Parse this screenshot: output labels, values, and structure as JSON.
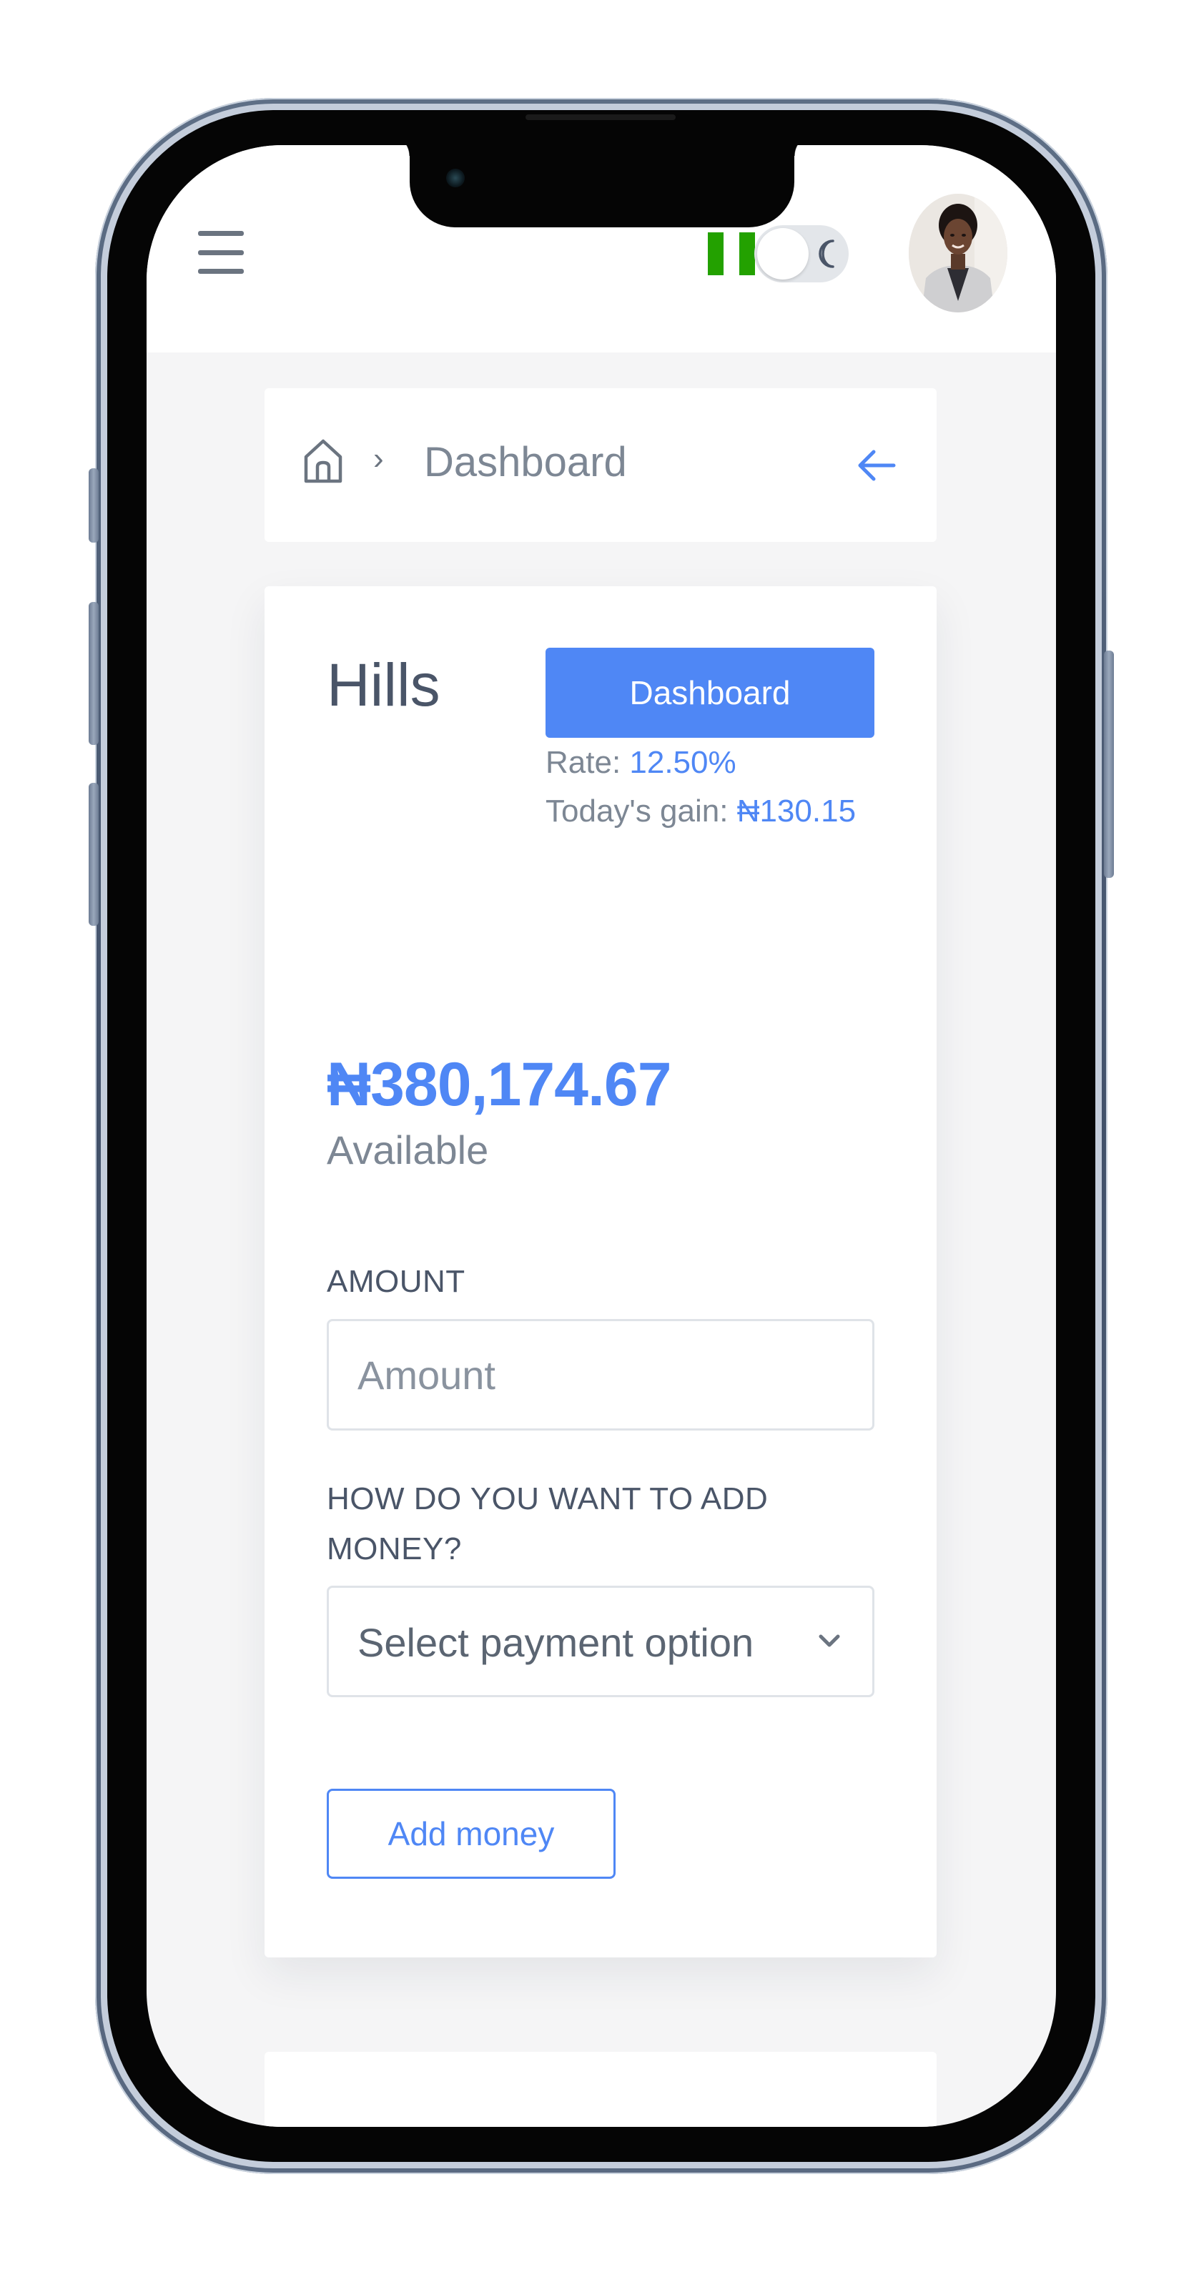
{
  "topbar": {
    "menu_icon": "hamburger-menu-icon",
    "flag_icon": "nigeria-flag-icon",
    "flag_colors": [
      "#23a100",
      "#ffffff",
      "#23a100"
    ],
    "theme_toggle_icon": "moon-icon",
    "avatar_icon": "user-avatar"
  },
  "breadcrumb": {
    "home_icon": "home-icon",
    "separator": "›",
    "current": "Dashboard",
    "back_icon": "arrow-left-icon"
  },
  "account": {
    "name": "Hills",
    "dashboard_button": "Dashboard",
    "rate_label": "Rate: ",
    "rate_value": "12.50%",
    "gain_label": "Today's gain: ",
    "gain_value": "₦130.15",
    "balance": "₦380,174.67",
    "balance_caption": "Available"
  },
  "form": {
    "amount_label": "AMOUNT",
    "amount_placeholder": "Amount",
    "amount_value": "",
    "method_label": "HOW DO YOU WANT TO ADD MONEY?",
    "method_selected": "Select payment option",
    "submit_label": "Add money"
  },
  "colors": {
    "accent": "#4f87f5",
    "text": "#4a5568",
    "muted": "#7d8794",
    "background": "#f5f5f6"
  }
}
